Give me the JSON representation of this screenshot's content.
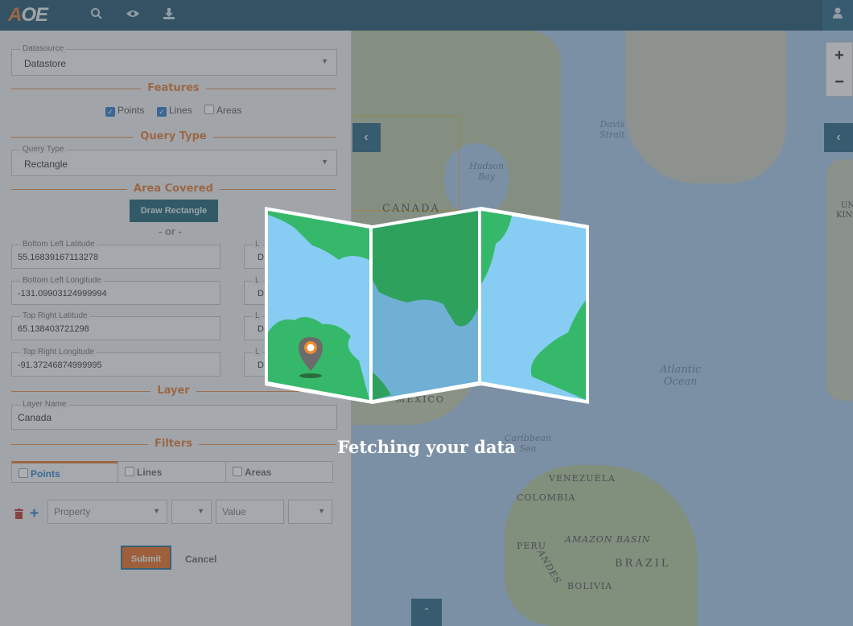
{
  "app": {
    "logo_prefix": "A",
    "logo_suffix": "OE"
  },
  "topbar": {
    "icons": [
      "search-icon",
      "eye-icon",
      "download-icon",
      "user-icon"
    ]
  },
  "panel": {
    "datasource": {
      "legend": "Datasource",
      "value": "Datastore"
    },
    "features": {
      "title": "Features",
      "options": [
        {
          "label": "Points",
          "checked": true
        },
        {
          "label": "Lines",
          "checked": true
        },
        {
          "label": "Areas",
          "checked": false
        }
      ]
    },
    "query_type": {
      "title": "Query Type",
      "legend": "Query Type",
      "value": "Rectangle"
    },
    "area": {
      "title": "Area Covered",
      "draw_button": "Draw Rectangle",
      "or_text": "- or -",
      "fields": [
        {
          "legend": "Bottom Left Latitude",
          "value": "55.16839167113278"
        },
        {
          "legend": "Bottom Left Longitude",
          "value": "-131.09903124999994"
        },
        {
          "legend": "Top Right Latitude",
          "value": "65.138403721298"
        },
        {
          "legend": "Top Right Longitude",
          "value": "-91.37246874999995"
        }
      ],
      "right_fields": [
        {
          "legend": "L",
          "value": "D"
        },
        {
          "legend": "L",
          "value": "D"
        },
        {
          "legend": "L",
          "value": "D"
        },
        {
          "legend": "L",
          "value": "D"
        }
      ]
    },
    "layer": {
      "title": "Layer",
      "legend": "Layer Name",
      "value": "Canada"
    },
    "filters": {
      "title": "Filters",
      "tabs": [
        {
          "label": "Points",
          "active": true
        },
        {
          "label": "Lines",
          "active": false
        },
        {
          "label": "Areas",
          "active": false
        }
      ],
      "row": {
        "property_placeholder": "Property",
        "value_placeholder": "Value"
      }
    },
    "actions": {
      "submit": "Submit",
      "cancel": "Cancel"
    }
  },
  "map": {
    "labels": {
      "canada": "CANADA",
      "hudson_bay": "Hudson\nBay",
      "davis_strait": "Davis\nStrait",
      "atlantic": "Atlantic\nOcean",
      "mexico": "MEXICO",
      "caribbean": "Caribbean\nSea",
      "venezuela": "VENEZUELA",
      "colombia": "COLOMBIA",
      "amazon": "AMAZON BASIN",
      "peru": "PERU",
      "brazil": "BRAZIL",
      "bolivia": "BOLIVIA",
      "andes": "ANDES",
      "right_edge_1": "UN",
      "right_edge_2": "KIN"
    },
    "zoom_in": "+",
    "zoom_out": "−"
  },
  "loading": {
    "message": "Fetching your data"
  },
  "colors": {
    "accent": "#e07a33",
    "topbar": "#23566e",
    "teal_button": "#1f6370"
  }
}
